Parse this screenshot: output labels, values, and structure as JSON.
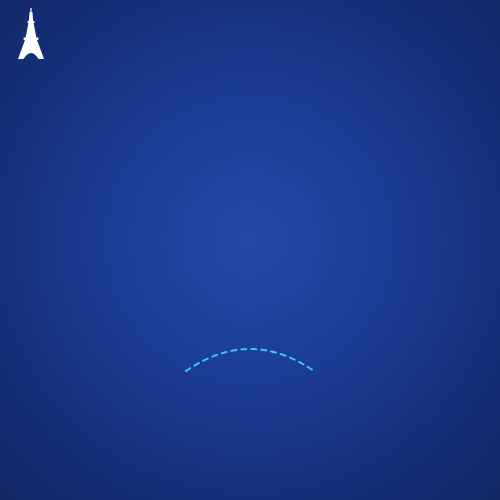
{
  "app": {
    "logo_icon": "eiffel-tower-icon",
    "background_color": "#1c3f97",
    "accent_color": "#3fc3ff"
  },
  "loading_indicator": {
    "icon": "loading-spinner-icon",
    "color": "#3fc3ff",
    "state": "loading"
  }
}
